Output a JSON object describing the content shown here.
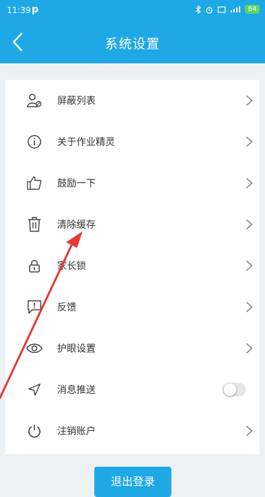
{
  "status_bar": {
    "time": "11:39",
    "app_glyph": "p",
    "battery": "84"
  },
  "header": {
    "title": "系统设置"
  },
  "settings": {
    "items": [
      {
        "label": "屏蔽列表",
        "icon": "user-block-icon"
      },
      {
        "label": "关于作业精灵",
        "icon": "info-icon"
      },
      {
        "label": "鼓励一下",
        "icon": "thumbs-up-icon"
      },
      {
        "label": "清除缓存",
        "icon": "trash-icon"
      },
      {
        "label": "家长锁",
        "icon": "lock-icon"
      },
      {
        "label": "反馈",
        "icon": "feedback-icon"
      },
      {
        "label": "护眼设置",
        "icon": "eye-icon"
      },
      {
        "label": "消息推送",
        "icon": "send-icon",
        "toggle": false
      },
      {
        "label": "注销账户",
        "icon": "power-icon"
      }
    ]
  },
  "footer": {
    "logout_label": "退出登录"
  },
  "colors": {
    "brand": "#1ea8e6",
    "annotation_arrow": "#e53935"
  }
}
